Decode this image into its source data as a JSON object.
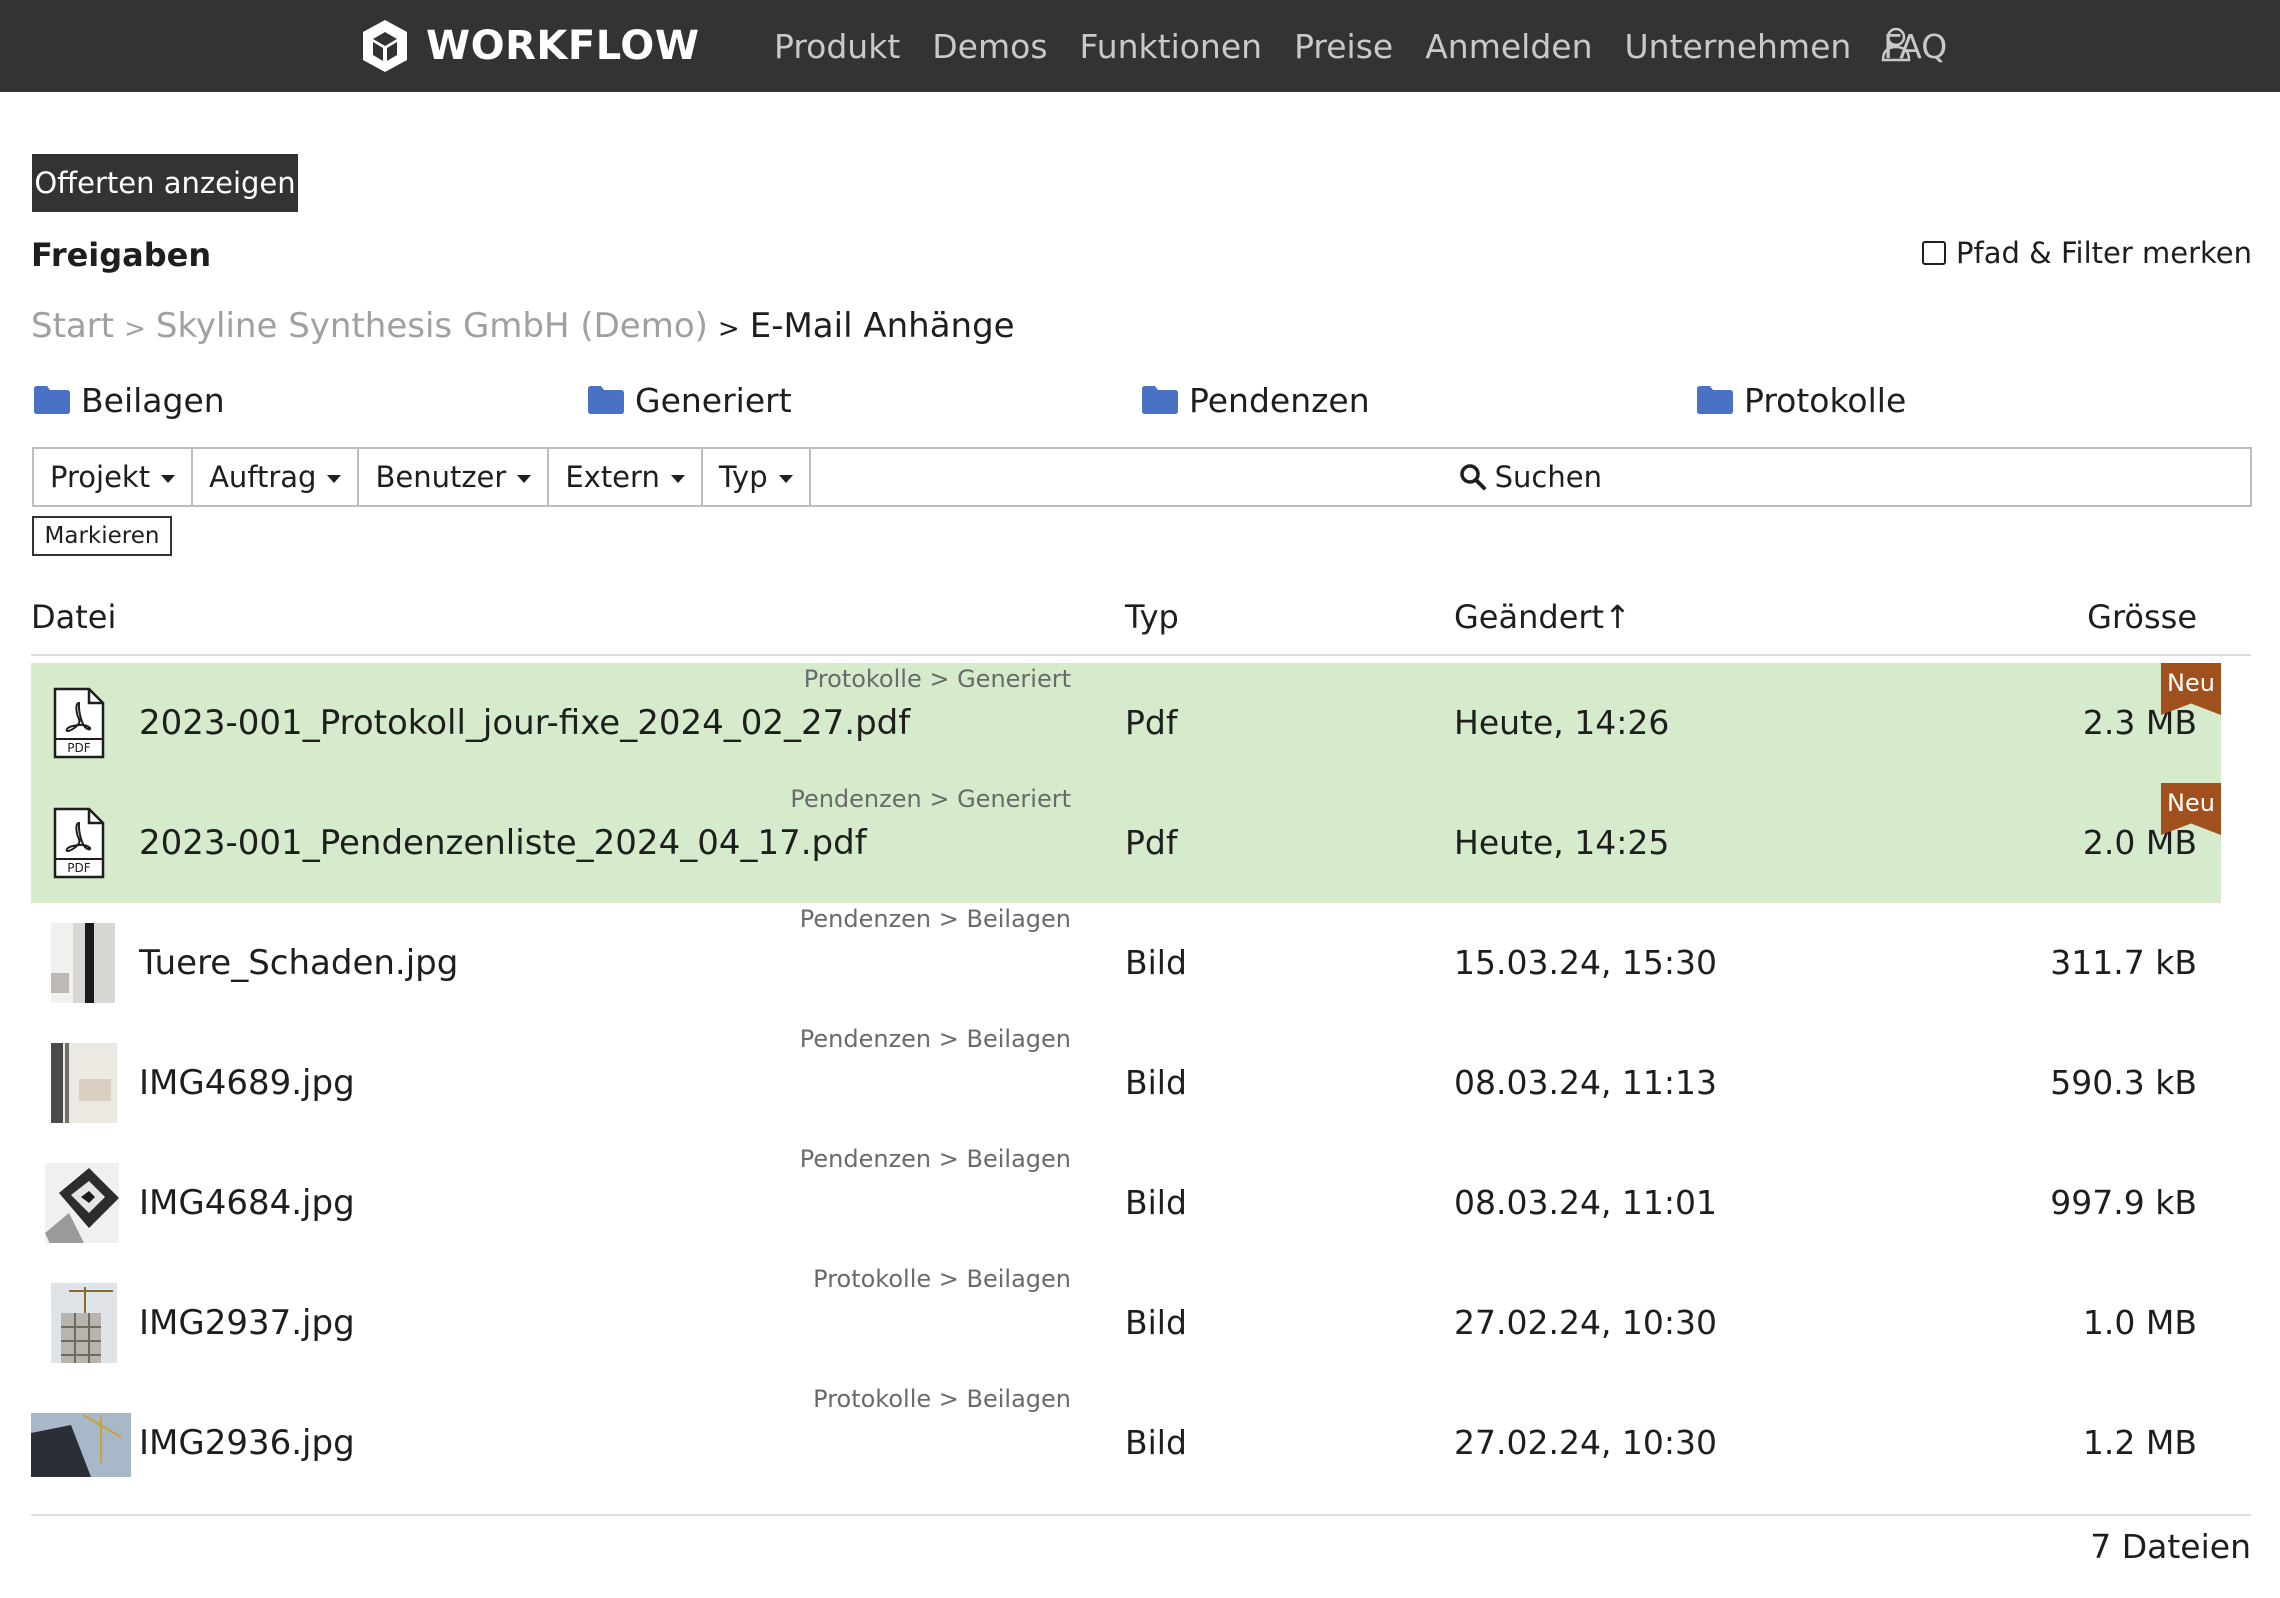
{
  "header": {
    "brand": "WORKFLOW",
    "nav": [
      "Produkt",
      "Demos",
      "Funktionen",
      "Preise",
      "Anmelden",
      "Unternehmen",
      "FAQ"
    ],
    "icons": [
      "cube-logo-icon",
      "user-icon"
    ]
  },
  "toolbar": {
    "offers_button": "Offerten anzeigen",
    "mark_button": "Markieren"
  },
  "section": {
    "title": "Freigaben",
    "remember_label": "Pfad & Filter merken",
    "remember_checked": false
  },
  "breadcrumb": {
    "items": [
      "Start",
      "Skyline Synthesis GmbH (Demo)"
    ],
    "separator": ">",
    "current": "E-Mail Anhänge"
  },
  "folders": [
    "Beilagen",
    "Generiert",
    "Pendenzen",
    "Protokolle"
  ],
  "filters": [
    "Projekt",
    "Auftrag",
    "Benutzer",
    "Extern",
    "Typ"
  ],
  "search_label": "Suchen",
  "table": {
    "headers": {
      "file": "Datei",
      "type": "Typ",
      "changed": "Geändert↑",
      "size": "Grösse"
    },
    "rows": [
      {
        "path": "Protokolle > Generiert",
        "name": "2023-001_Protokoll_jour-fixe_2024_02_27.pdf",
        "type": "Pdf",
        "changed": "Heute, 14:26",
        "size": "2.3 MB",
        "badge": "Neu",
        "icon": "pdf-icon",
        "is_new": true
      },
      {
        "path": "Pendenzen > Generiert",
        "name": "2023-001_Pendenzenliste_2024_04_17.pdf",
        "type": "Pdf",
        "changed": "Heute, 14:25",
        "size": "2.0 MB",
        "badge": "Neu",
        "icon": "pdf-icon",
        "is_new": true
      },
      {
        "path": "Pendenzen > Beilagen",
        "name": "Tuere_Schaden.jpg",
        "type": "Bild",
        "changed": "15.03.24, 15:30",
        "size": "311.7 kB",
        "icon": "image-thumbnail"
      },
      {
        "path": "Pendenzen > Beilagen",
        "name": "IMG4689.jpg",
        "type": "Bild",
        "changed": "08.03.24, 11:13",
        "size": "590.3 kB",
        "icon": "image-thumbnail"
      },
      {
        "path": "Pendenzen > Beilagen",
        "name": "IMG4684.jpg",
        "type": "Bild",
        "changed": "08.03.24, 11:01",
        "size": "997.9 kB",
        "icon": "image-thumbnail"
      },
      {
        "path": "Protokolle > Beilagen",
        "name": "IMG2937.jpg",
        "type": "Bild",
        "changed": "27.02.24, 10:30",
        "size": "1.0 MB",
        "icon": "image-thumbnail"
      },
      {
        "path": "Protokolle > Beilagen",
        "name": "IMG2936.jpg",
        "type": "Bild",
        "changed": "27.02.24, 10:30",
        "size": "1.2 MB",
        "icon": "image-thumbnail"
      }
    ]
  },
  "footer": {
    "count": "7 Dateien"
  },
  "colors": {
    "topbar": "#333333",
    "new_row": "#d6ebcb",
    "badge": "#a0501c",
    "folder": "#4a72c4",
    "muted_text": "#a0a0a0"
  }
}
